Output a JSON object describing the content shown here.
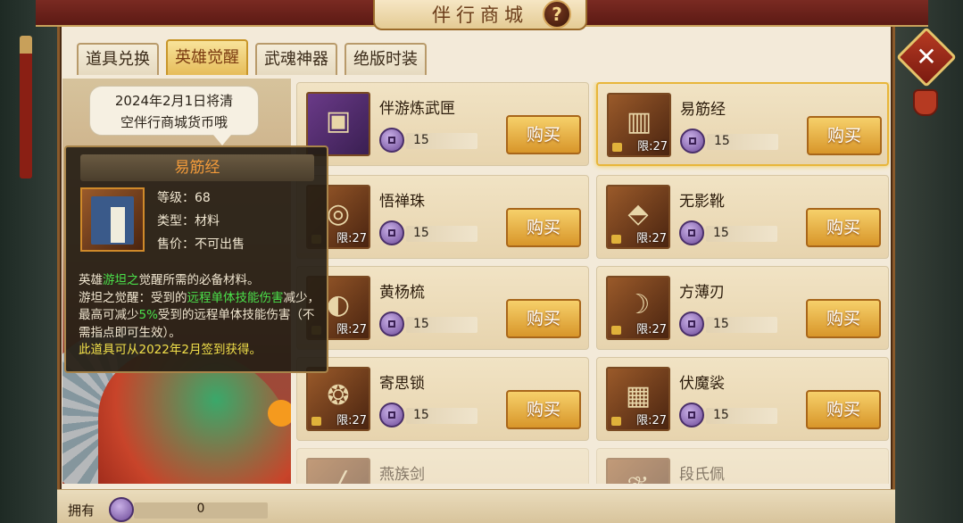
{
  "window": {
    "title": "伴行商城",
    "help_label": "?",
    "close_label": "✕"
  },
  "tabs": [
    {
      "label": "道具兑换",
      "active": false
    },
    {
      "label": "英雄觉醒",
      "active": true
    },
    {
      "label": "武魂神器",
      "active": false
    },
    {
      "label": "绝版时装",
      "active": false
    }
  ],
  "notice": {
    "line1": "2024年2月1日将清",
    "line2": "空伴行商城货币哦"
  },
  "items": [
    {
      "name": "伴游炼武匣",
      "price": "15",
      "limit": "",
      "buy_label": "购买",
      "icon": "chest-icon",
      "glyph": "▣"
    },
    {
      "name": "易筋经",
      "price": "15",
      "limit": "限:27",
      "buy_label": "购买",
      "icon": "book-icon",
      "glyph": "▥"
    },
    {
      "name": "悟禅珠",
      "price": "15",
      "limit": "限:27",
      "buy_label": "购买",
      "icon": "beads-icon",
      "glyph": "◎"
    },
    {
      "name": "无影靴",
      "price": "15",
      "limit": "限:27",
      "buy_label": "购买",
      "icon": "boots-icon",
      "glyph": "⬘"
    },
    {
      "name": "黄杨梳",
      "price": "15",
      "limit": "限:27",
      "buy_label": "购买",
      "icon": "comb-icon",
      "glyph": "◐"
    },
    {
      "name": "方薄刃",
      "price": "15",
      "limit": "限:27",
      "buy_label": "购买",
      "icon": "blade-icon",
      "glyph": "☽"
    },
    {
      "name": "寄思锁",
      "price": "15",
      "limit": "限:27",
      "buy_label": "购买",
      "icon": "lock-pendant-icon",
      "glyph": "❂"
    },
    {
      "name": "伏魔裟",
      "price": "15",
      "limit": "限:27",
      "buy_label": "购买",
      "icon": "robe-icon",
      "glyph": "▦"
    },
    {
      "name": "燕族剑",
      "price": "",
      "limit": "",
      "buy_label": "",
      "icon": "sword-icon",
      "glyph": "╱"
    },
    {
      "name": "段氏佩",
      "price": "",
      "limit": "",
      "buy_label": "",
      "icon": "jade-pendant-icon",
      "glyph": "❦"
    }
  ],
  "tooltip": {
    "title": "易筋经",
    "level_label": "等级：",
    "level_value": "68",
    "type_label": "类型：",
    "type_value": "材料",
    "sell_label": "售价：",
    "sell_value": "不可出售",
    "desc_p1": "英雄",
    "desc_hero": "游坦之",
    "desc_p2": "觉醒所需的必备材料。",
    "desc_p3": "游坦之觉醒：受到的",
    "desc_hl1": "远程单体技能伤害",
    "desc_p4": "减少，最高可减少",
    "desc_hl2": "5%",
    "desc_p5": "受到的远程单体技能伤害（不需指点即可生效）。",
    "desc_source": "此道具可从2022年2月签到获得。"
  },
  "footer": {
    "own_label": "拥有",
    "own_value": "0"
  },
  "colors": {
    "accent": "#e6bd5a",
    "highlight_green": "#4ae04a",
    "highlight_yellow": "#f2e04a",
    "tooltip_title": "#f29a3a"
  }
}
